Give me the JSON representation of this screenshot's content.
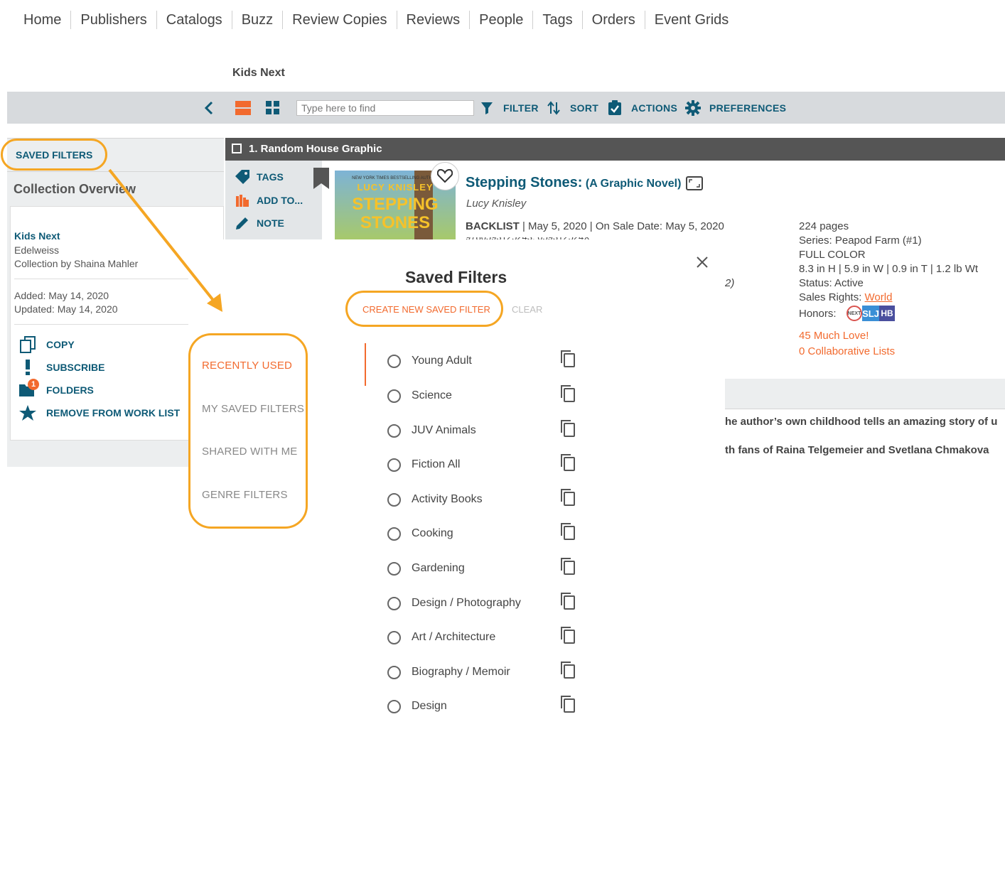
{
  "nav": [
    "Home",
    "Publishers",
    "Catalogs",
    "Buzz",
    "Review Copies",
    "Reviews",
    "People",
    "Tags",
    "Orders",
    "Event Grids"
  ],
  "collection_title": "Kids Next",
  "toolbar": {
    "search_placeholder": "Type here to find",
    "filter": "FILTER",
    "sort": "SORT",
    "actions": "ACTIONS",
    "preferences": "PREFERENCES"
  },
  "left": {
    "saved_filters": "SAVED FILTERS",
    "overview": "Collection Overview",
    "card_title": "Kids Next",
    "card_org": "Edelweiss",
    "card_by": "Collection by Shaina Mahler",
    "added": "Added: May 14, 2020",
    "updated": "Updated: May 14, 2020",
    "actions": {
      "copy": "COPY",
      "subscribe": "SUBSCRIBE",
      "folders": "FOLDERS",
      "remove": "REMOVE FROM WORK LIST"
    },
    "folder_badge": "1"
  },
  "result": {
    "header": "1. Random House Graphic",
    "side": {
      "tags": "TAGS",
      "add": "ADD TO...",
      "note": "NOTE"
    },
    "cover": {
      "tagline": "NEW YORK TIMES BESTSELLING AUTHOR",
      "author": "LUCY KNISLEY",
      "title1": "STEPPING",
      "title2": "STONES"
    },
    "title": "Stepping Stones:",
    "subtitle": "(A Graphic Novel)",
    "author": "Lucy Knisley",
    "status_label": "BACKLIST",
    "dates": " | May 5, 2020 | On Sale Date: May 5, 2020",
    "isbn_partial": "9780593125243, 059312524X",
    "pages": "224 pages",
    "series": "Series: Peapod Farm (#1)",
    "color": "FULL COLOR",
    "dims": "8.3 in H | 5.9 in W | 0.9 in T | 1.2 lb Wt",
    "status": "Status: Active",
    "rights_label": "Sales Rights: ",
    "rights_value": "World",
    "honors": "Honors:",
    "honor_badges": [
      "NEXT",
      "SLJ",
      "HB"
    ],
    "much_love": "45 Much Love!",
    "collab": "0 Collaborative Lists",
    "desc1": "he author’s own childhood tells an amazing story of u",
    "desc2": "th fans of Raina Telgemeier and Svetlana Chmakova",
    "paren": "2)"
  },
  "modal": {
    "title": "Saved Filters",
    "create": "CREATE NEW SAVED FILTER",
    "clear": "CLEAR",
    "categories": [
      "RECENTLY USED",
      "MY SAVED FILTERS",
      "SHARED WITH ME",
      "GENRE FILTERS"
    ],
    "filters": [
      "Young Adult",
      "Science",
      "JUV Animals",
      "Fiction All",
      "Activity Books",
      "Cooking",
      "Gardening",
      "Design / Photography",
      "Art / Architecture",
      "Biography / Memoir",
      "Design"
    ]
  },
  "colors": {
    "accent": "#f26a2e",
    "brand": "#0e5a76",
    "highlight": "#f5a623"
  }
}
